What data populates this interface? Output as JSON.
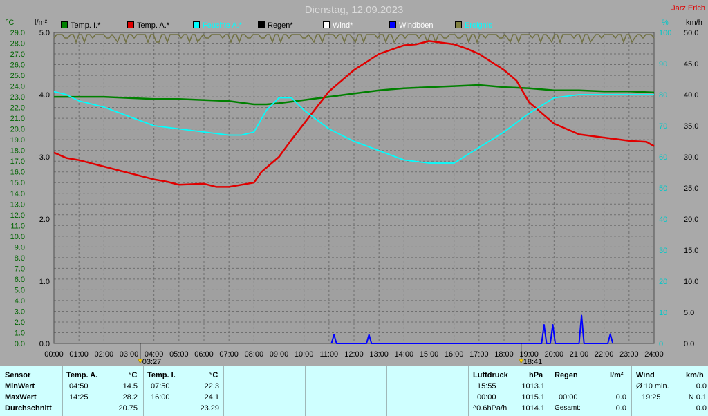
{
  "title": "Dienstag, 12.09.2023",
  "author": "Jarz Erich",
  "axis_units": {
    "temp": "°C",
    "rain": "l/m²",
    "humidity": "%",
    "wind": "km/h"
  },
  "legend": [
    {
      "label": "Temp. I.*",
      "color": "#008000"
    },
    {
      "label": "Temp. A.*",
      "color": "#e00000"
    },
    {
      "label": "Feuchte A.*",
      "color": "#00ffff"
    },
    {
      "label": "Regen*",
      "color": "#000000"
    },
    {
      "label": "Wind*",
      "color": "#ffffff"
    },
    {
      "label": "Windböen",
      "color": "#0000ff"
    },
    {
      "label": "Ereignis",
      "color": "#808040"
    }
  ],
  "sun_markers": {
    "sunrise": "03:27",
    "sunset": "18:41"
  },
  "chart_data": {
    "type": "line",
    "title": "Dienstag, 12.09.2023",
    "x_labels": [
      "00:00",
      "01:00",
      "02:00",
      "03:00",
      "04:00",
      "05:00",
      "06:00",
      "07:00",
      "08:00",
      "09:00",
      "10:00",
      "11:00",
      "12:00",
      "13:00",
      "14:00",
      "15:00",
      "16:00",
      "17:00",
      "18:00",
      "19:00",
      "20:00",
      "21:00",
      "22:00",
      "23:00",
      "24:00"
    ],
    "xlim": [
      0,
      24
    ],
    "temp_ticks": [
      "29.0",
      "28.0",
      "27.0",
      "26.0",
      "25.0",
      "24.0",
      "23.0",
      "22.0",
      "21.0",
      "20.0",
      "19.0",
      "18.0",
      "17.0",
      "16.0",
      "15.0",
      "14.0",
      "13.0",
      "12.0",
      "11.0",
      "10.0",
      "9.0",
      "8.0",
      "7.0",
      "6.0",
      "5.0",
      "4.0",
      "3.0",
      "2.0",
      "1.0",
      "0.0"
    ],
    "rain_ticks": [
      "5.0",
      "4.0",
      "3.0",
      "2.0",
      "1.0",
      "0.0"
    ],
    "humidity_ticks": [
      "100",
      "90",
      "80",
      "70",
      "60",
      "50",
      "40",
      "30",
      "20",
      "10",
      "0"
    ],
    "wind_ticks": [
      "50.0",
      "45.0",
      "40.0",
      "35.0",
      "30.0",
      "25.0",
      "20.0",
      "15.0",
      "10.0",
      "5.0",
      "0.0"
    ],
    "ylim_temp": [
      0,
      29
    ],
    "ylim_humidity": [
      0,
      100
    ],
    "ylim_wind": [
      0,
      50
    ],
    "series": [
      {
        "name": "Temp. I.*",
        "color": "#008000",
        "axis": "temp",
        "x": [
          0,
          1,
          2,
          3,
          4,
          5,
          6,
          7,
          8,
          8.5,
          9,
          10,
          11,
          12,
          13,
          14,
          15,
          16,
          17,
          18,
          19,
          20,
          21,
          22,
          23,
          24
        ],
        "y": [
          23.0,
          23.0,
          23.0,
          22.9,
          22.8,
          22.8,
          22.7,
          22.6,
          22.3,
          22.3,
          22.4,
          22.7,
          23.0,
          23.3,
          23.6,
          23.8,
          23.9,
          24.0,
          24.1,
          23.9,
          23.8,
          23.6,
          23.6,
          23.5,
          23.5,
          23.4
        ]
      },
      {
        "name": "Temp. A.*",
        "color": "#e00000",
        "axis": "temp",
        "x": [
          0,
          0.5,
          1,
          2,
          3,
          3.5,
          4,
          4.5,
          5,
          6,
          6.5,
          7,
          8,
          8.3,
          9,
          9.5,
          10,
          11,
          12,
          13,
          14,
          14.5,
          15,
          16,
          16.5,
          17,
          18,
          18.5,
          19,
          20,
          21,
          22,
          23,
          23.7,
          24
        ],
        "y": [
          17.8,
          17.3,
          17.1,
          16.5,
          15.9,
          15.6,
          15.3,
          15.1,
          14.8,
          14.9,
          14.6,
          14.6,
          15.0,
          16.0,
          17.4,
          19.0,
          20.5,
          23.5,
          25.5,
          27.0,
          27.8,
          27.9,
          28.2,
          27.9,
          27.5,
          27.0,
          25.5,
          24.5,
          22.5,
          20.5,
          19.5,
          19.2,
          18.9,
          18.8,
          18.4
        ]
      },
      {
        "name": "Feuchte A.*",
        "color": "#00ffff",
        "axis": "humidity",
        "x": [
          0,
          0.5,
          1,
          2,
          3,
          4,
          5,
          6,
          7,
          7.5,
          8,
          8.5,
          9,
          9.5,
          10,
          11,
          12,
          13,
          14,
          15,
          16,
          17,
          18,
          19,
          20,
          21,
          22,
          23,
          24
        ],
        "y": [
          81,
          80,
          78,
          76,
          73,
          70,
          69,
          68,
          67,
          67,
          68,
          75,
          79,
          79,
          75,
          69,
          65,
          62,
          59,
          58,
          58,
          63,
          68,
          74,
          79,
          80,
          80,
          80,
          80
        ]
      },
      {
        "name": "Windböen",
        "color": "#0000ff",
        "axis": "wind",
        "x": [
          11.1,
          11.2,
          11.3,
          12.5,
          12.6,
          12.7,
          19.5,
          19.6,
          19.7,
          19.85,
          19.95,
          20.05,
          21.0,
          21.1,
          21.2,
          22.15,
          22.25,
          22.35
        ],
        "y": [
          0,
          1.4,
          0,
          0,
          1.4,
          0,
          0,
          3.0,
          0,
          0,
          3.0,
          0,
          0,
          4.5,
          0,
          0,
          1.5,
          0
        ]
      }
    ]
  },
  "table": {
    "temp_a": {
      "title": "Temp. A.",
      "unit": "°C",
      "min_time": "04:50",
      "min": "14.5",
      "max_time": "14:25",
      "max": "28.2",
      "avg": "20.75"
    },
    "temp_i": {
      "title": "Temp. I.",
      "unit": "°C",
      "min_time": "07:50",
      "min": "22.3",
      "max_time": "16:00",
      "max": "24.1",
      "avg": "23.29"
    },
    "row_labels": {
      "header": "Sensor",
      "min": "MinWert",
      "max": "MaxWert",
      "avg": "Durchschnitt"
    },
    "pressure": {
      "title": "Luftdruck",
      "unit": "hPa",
      "t1": "15:55",
      "v1": "1013.1",
      "t2": "00:00",
      "v2": "1015.1",
      "t3": "^0.6hPa/h",
      "v3": "1014.1"
    },
    "rain": {
      "title": "Regen",
      "unit": "l/m²",
      "t2": "00:00",
      "v2": "0.0",
      "t3": "Gesamt:",
      "v3": "0.0"
    },
    "wind": {
      "title": "Wind",
      "unit": "km/h",
      "t1": "Ø 10 min.",
      "v1": "0.0",
      "t2": "19:25",
      "v2": "N 0.1",
      "v3": "0.0"
    }
  }
}
